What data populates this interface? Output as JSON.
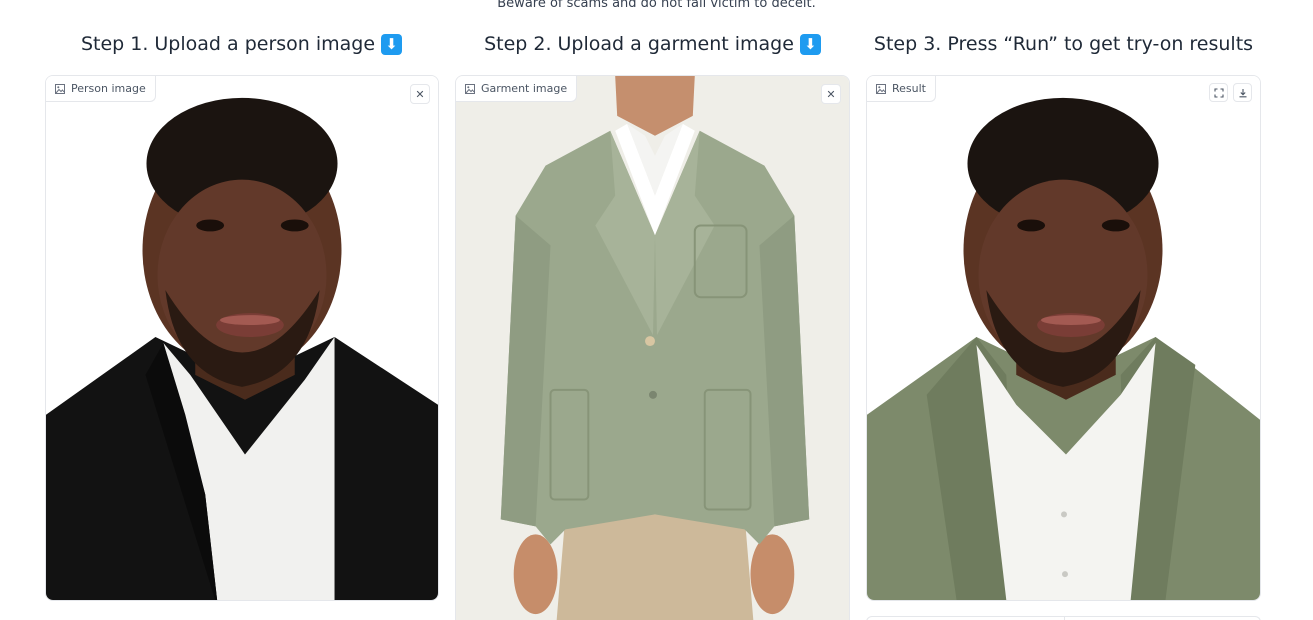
{
  "notice": "Beware of scams and do not fall victim to deceit.",
  "steps": [
    {
      "title": "Step 1. Upload a person image",
      "emoji": "⬇"
    },
    {
      "title": "Step 2. Upload a garment image",
      "emoji": "⬇"
    },
    {
      "title": "Step 3. Press “Run” to get try-on results",
      "emoji": ""
    }
  ],
  "panels": {
    "person": {
      "label": "Person image",
      "clear_icon": "close-icon"
    },
    "garment": {
      "label": "Garment image",
      "clear_icon": "close-icon"
    },
    "result": {
      "label": "Result",
      "fullscreen_icon": "fullscreen-icon",
      "download_icon": "download-icon"
    }
  },
  "colors": {
    "accent_emoji": "#1e9bf0",
    "border": "#e5e7eb",
    "suit_black": "#121212",
    "jacket_green": "#9ba88d",
    "garment_bg": "#efeee8"
  }
}
